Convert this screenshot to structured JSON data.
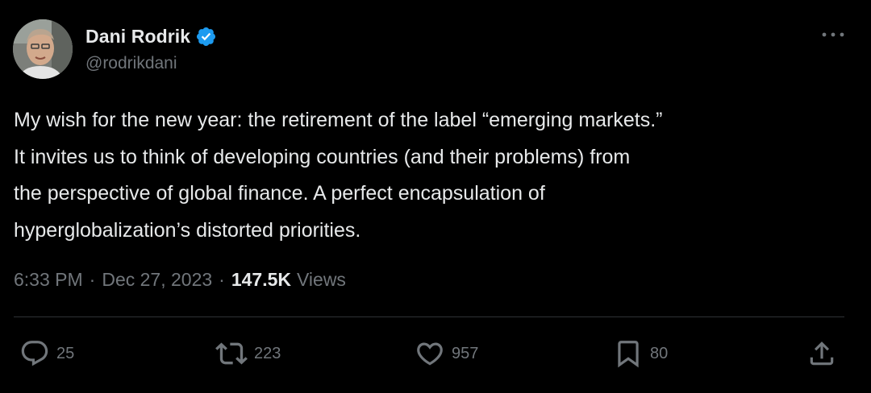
{
  "author": {
    "name": "Dani Rodrik",
    "handle": "@rodrikdani",
    "verified_color": "#1d9bf0"
  },
  "tweet": {
    "text_lines": [
      "My wish for the new year: the retirement of the label “emerging markets.”",
      "It invites us to think of developing countries (and their problems) from",
      "the perspective of global finance. A perfect encapsulation of",
      "hyperglobalization’s distorted priorities."
    ]
  },
  "meta": {
    "time": "6:33 PM",
    "separator": "·",
    "date": "Dec 27, 2023",
    "views_count": "147.5K",
    "views_label": "Views"
  },
  "actions": {
    "replies": "25",
    "reposts": "223",
    "likes": "957",
    "bookmarks": "80"
  },
  "icons": {
    "avatar": "avatar",
    "verified": "verified-badge-icon",
    "more": "more-icon",
    "reply": "reply-icon",
    "repost": "repost-icon",
    "like": "heart-icon",
    "bookmark": "bookmark-icon",
    "share": "share-icon"
  }
}
